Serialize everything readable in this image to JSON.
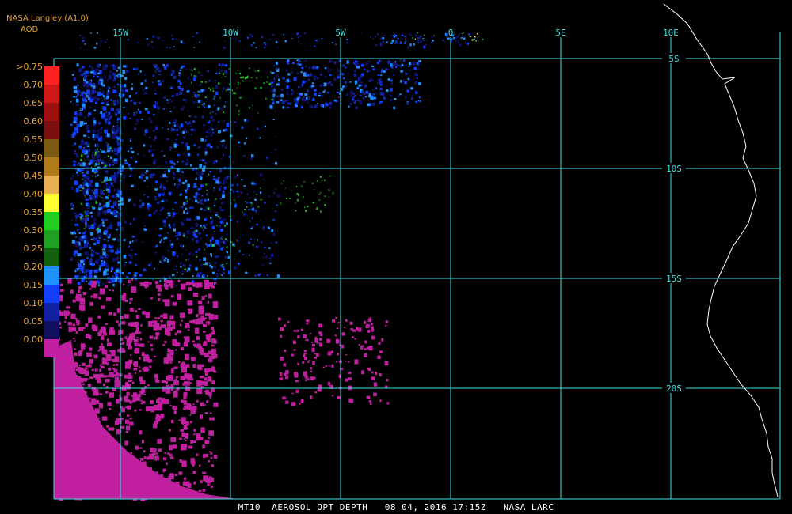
{
  "header": {
    "source": "NASA Langley (A1.0)",
    "product": "AOD"
  },
  "legend": {
    "entries": [
      {
        "label": ">0.75",
        "color": "#ff2020"
      },
      {
        "label": "0.70",
        "color": "#d01818"
      },
      {
        "label": "0.65",
        "color": "#a01010"
      },
      {
        "label": "0.60",
        "color": "#7a1010"
      },
      {
        "label": "0.55",
        "color": "#7a5a10"
      },
      {
        "label": "0.50",
        "color": "#b07a18"
      },
      {
        "label": "0.45",
        "color": "#e8b050"
      },
      {
        "label": "0.40",
        "color": "#ffff30"
      },
      {
        "label": "0.35",
        "color": "#20d020"
      },
      {
        "label": "0.30",
        "color": "#20a020"
      },
      {
        "label": "0.25",
        "color": "#106010"
      },
      {
        "label": "0.20",
        "color": "#2090ff"
      },
      {
        "label": "0.15",
        "color": "#1040ff"
      },
      {
        "label": "0.10",
        "color": "#1020a0"
      },
      {
        "label": "0.05",
        "color": "#101060"
      },
      {
        "label": "0.00",
        "color": "#c020a0"
      }
    ]
  },
  "grid": {
    "longitude_labels": [
      "15W",
      "10W",
      "5W",
      "0",
      "5E",
      "10E"
    ],
    "latitude_labels": [
      "5S",
      "10S",
      "15S",
      "20S"
    ],
    "line_color": "#3fe0e0"
  },
  "footer": {
    "text": "MT10  AEROSOL OPT DEPTH   08 04, 2016 17:15Z   NASA LARC"
  }
}
